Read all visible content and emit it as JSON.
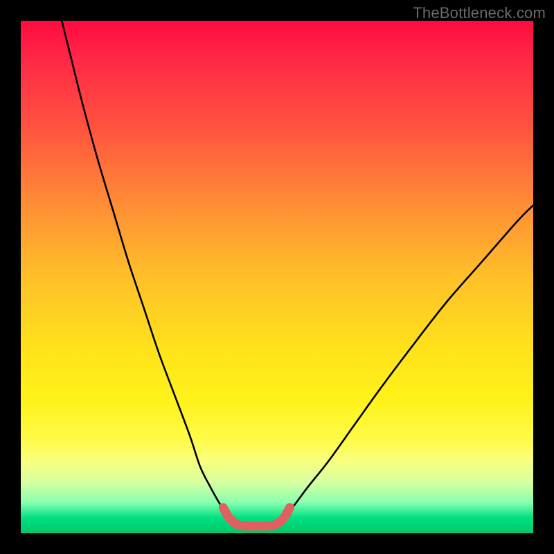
{
  "watermark": "TheBottleneck.com",
  "chart_data": {
    "type": "line",
    "title": "",
    "xlabel": "",
    "ylabel": "",
    "xlim": [
      0,
      100
    ],
    "ylim": [
      0,
      100
    ],
    "grid": false,
    "series": [
      {
        "name": "left-curve",
        "stroke": "#000000",
        "x": [
          8,
          10,
          12,
          15,
          18,
          21,
          24,
          27,
          30,
          33,
          35,
          37,
          39,
          41,
          42.5
        ],
        "y": [
          100,
          92,
          84,
          73,
          63,
          53,
          44,
          35,
          27,
          19,
          13,
          9,
          5.5,
          3,
          2
        ]
      },
      {
        "name": "right-curve",
        "stroke": "#000000",
        "x": [
          49.5,
          51,
          53,
          56,
          60,
          65,
          70,
          76,
          83,
          90,
          97,
          100
        ],
        "y": [
          2,
          3,
          5,
          9,
          14,
          21,
          28,
          36,
          45,
          53,
          61,
          64
        ]
      },
      {
        "name": "bottom-segment",
        "stroke": "#e06060",
        "x": [
          39.5,
          40.5,
          41.5,
          42.5,
          44,
          46,
          48,
          49.5,
          50.5,
          51.5,
          52.5
        ],
        "y": [
          5,
          3.2,
          2.2,
          1.6,
          1.4,
          1.4,
          1.4,
          1.6,
          2.2,
          3.2,
          5
        ]
      }
    ],
    "gradient": {
      "direction": "vertical",
      "top": "#ff0a40",
      "mid": "#ffe41a",
      "bottom": "#00c86a",
      "meaning": "red=bad, green=good; curve shows bottleneck mismatch vs. component balance"
    }
  }
}
